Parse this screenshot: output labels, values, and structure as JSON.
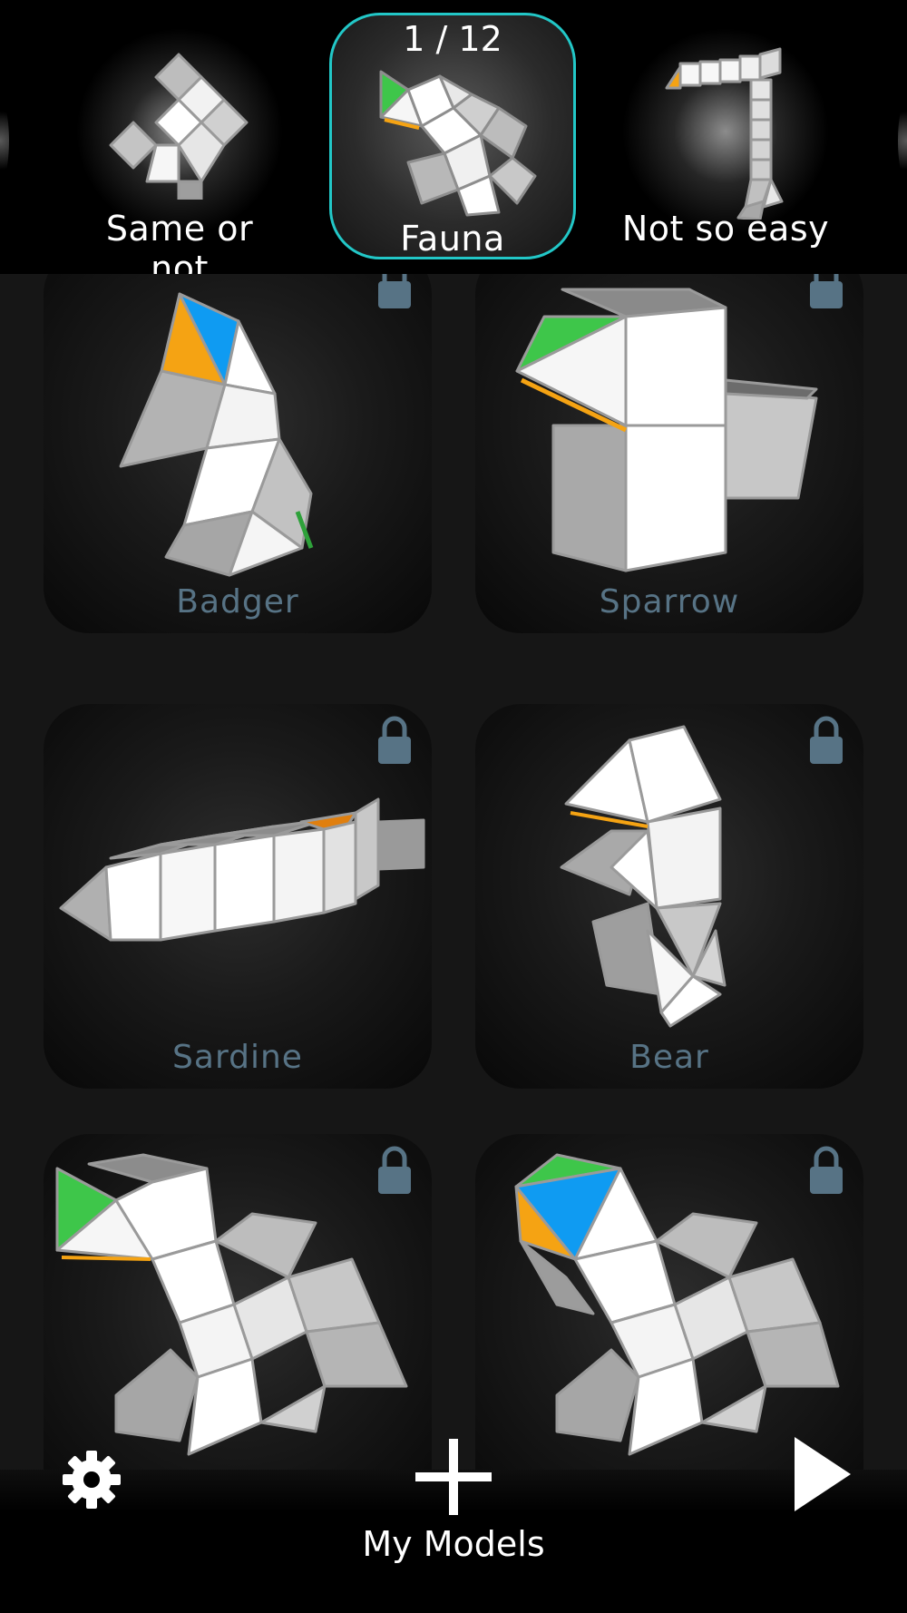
{
  "carousel": {
    "counter": "1 / 12",
    "categories": [
      {
        "label": "Same or not",
        "selected": false
      },
      {
        "label": "Fauna",
        "selected": true
      },
      {
        "label": "Not so easy",
        "selected": false
      }
    ],
    "selected_border_color": "#22c7c7"
  },
  "models": [
    {
      "name": "Badger",
      "locked": true
    },
    {
      "name": "Sparrow",
      "locked": true
    },
    {
      "name": "Sardine",
      "locked": true
    },
    {
      "name": "Bear",
      "locked": true
    },
    {
      "name": "",
      "locked": true
    },
    {
      "name": "",
      "locked": true
    }
  ],
  "colors": {
    "lock": "#577385",
    "model_name": "#577385",
    "accent_green": "#3ec64a",
    "accent_orange": "#f5a313",
    "accent_blue": "#0f9bf2"
  },
  "bottom_bar": {
    "settings_icon": "gear-icon",
    "add_icon": "plus-icon",
    "play_icon": "play-icon",
    "label": "My Models"
  }
}
